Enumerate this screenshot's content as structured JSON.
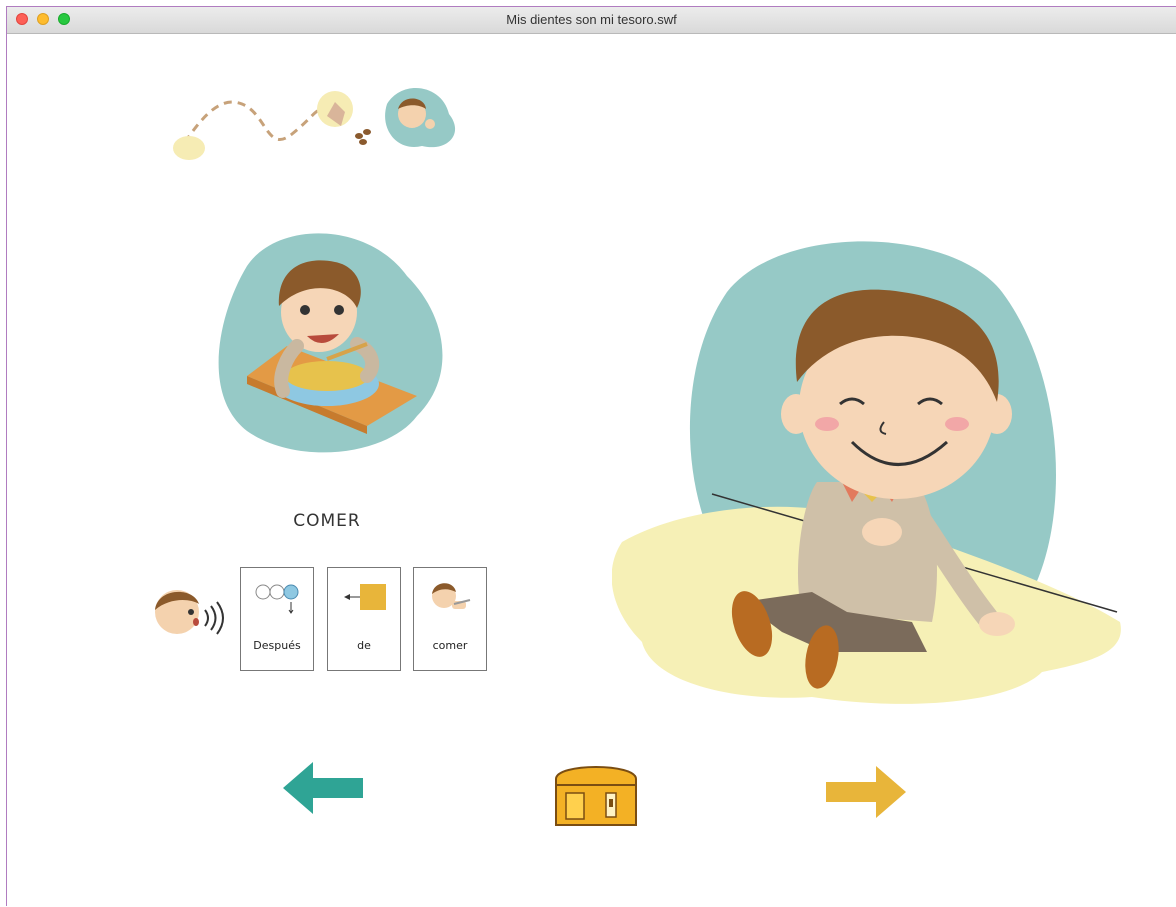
{
  "window": {
    "title": "Mis dientes son mi tesoro.swf"
  },
  "activity": {
    "word": "COMER",
    "pictograms": [
      {
        "label": "Después",
        "icon": "after-clock-icon"
      },
      {
        "label": "de",
        "icon": "arrow-square-icon"
      },
      {
        "label": "comer",
        "icon": "child-eating-icon"
      }
    ]
  },
  "navigation": {
    "back": "back-arrow-icon",
    "home": "treasure-chest-icon",
    "next": "next-arrow-icon"
  },
  "colors": {
    "teal_blob": "#96c9c6",
    "sand": "#f6f0b6",
    "back_arrow": "#2fa495",
    "next_arrow": "#e8b53a",
    "chest": "#f3b125"
  }
}
